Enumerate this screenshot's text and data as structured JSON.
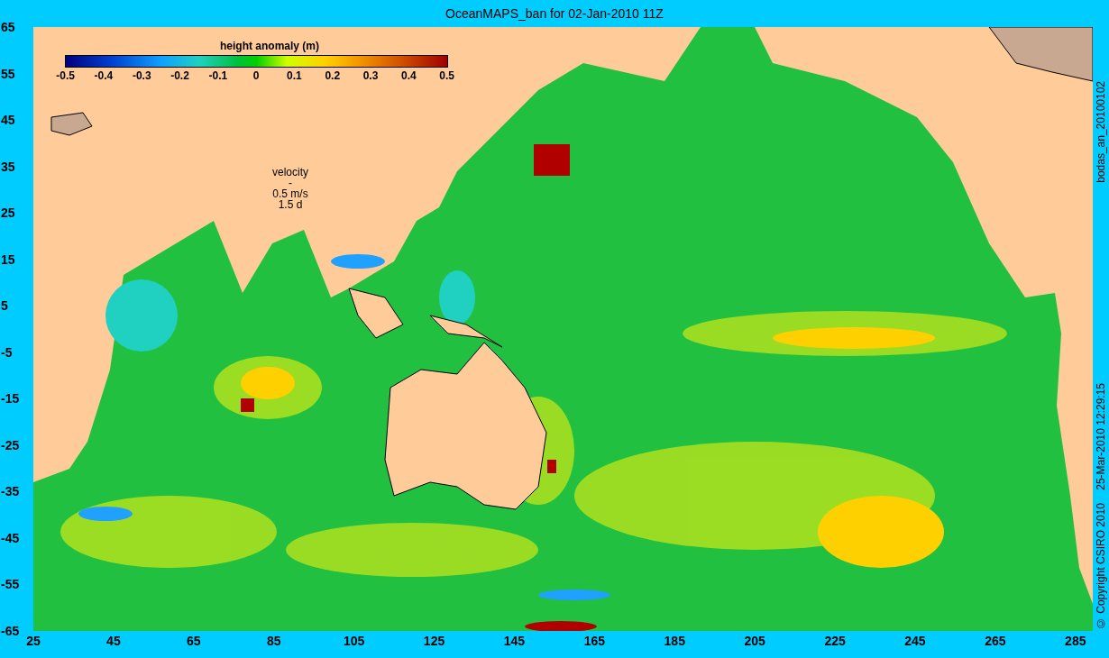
{
  "title": "OceanMAPS_ban for 02-Jan-2010 11Z",
  "colorbar": {
    "title": "height anomaly (m)",
    "tick_labels": [
      "-0.5",
      "-0.4",
      "-0.3",
      "-0.2",
      "-0.1",
      "0",
      "0.1",
      "0.2",
      "0.3",
      "0.4",
      "0.5"
    ]
  },
  "velocity_legend": {
    "label": "velocity",
    "arrow": "-",
    "speed": "0.5 m/s",
    "duration": "1.5 d"
  },
  "y_axis": {
    "tick_labels": [
      "65",
      "55",
      "45",
      "35",
      "25",
      "15",
      "5",
      "-5",
      "-15",
      "-25",
      "-35",
      "-45",
      "-55",
      "-65"
    ]
  },
  "x_axis": {
    "tick_labels": [
      "25",
      "45",
      "65",
      "85",
      "105",
      "125",
      "145",
      "165",
      "185",
      "205",
      "225",
      "245",
      "265",
      "285"
    ]
  },
  "side_notes": {
    "run_id": "bodas_an_20100102",
    "timestamp": "25-Mar-2010 12:29:15",
    "copyright": "© Copyright CSIRO 2010"
  }
}
